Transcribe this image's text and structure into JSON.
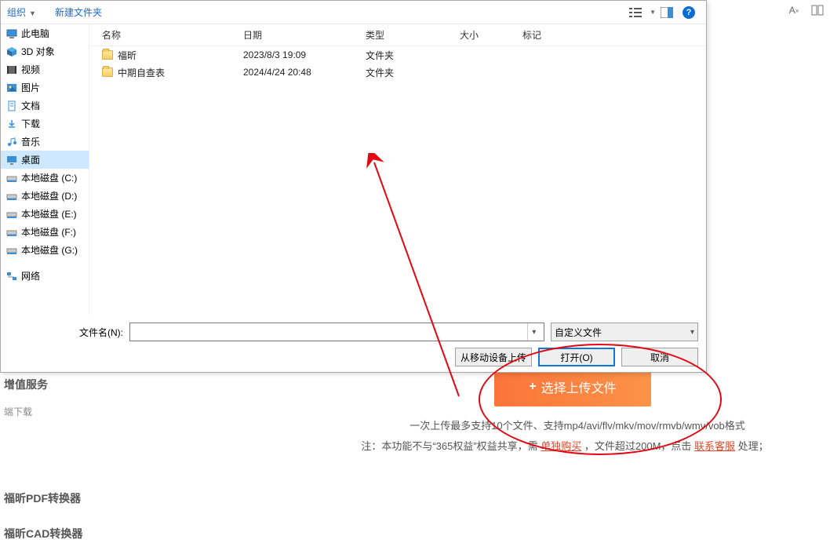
{
  "toolbar": {
    "organize": "组织",
    "newfolder": "新建文件夹"
  },
  "sidebar": {
    "items": [
      {
        "label": "此电脑"
      },
      {
        "label": "3D 对象"
      },
      {
        "label": "视频"
      },
      {
        "label": "图片"
      },
      {
        "label": "文档"
      },
      {
        "label": "下载"
      },
      {
        "label": "音乐"
      },
      {
        "label": "桌面"
      },
      {
        "label": "本地磁盘 (C:)"
      },
      {
        "label": "本地磁盘 (D:)"
      },
      {
        "label": "本地磁盘 (E:)"
      },
      {
        "label": "本地磁盘 (F:)"
      },
      {
        "label": "本地磁盘 (G:)"
      },
      {
        "label": ""
      },
      {
        "label": "网络"
      }
    ]
  },
  "columns": {
    "name": "名称",
    "date": "日期",
    "type": "类型",
    "size": "大小",
    "tag": "标记"
  },
  "files": [
    {
      "name": "福昕",
      "date": "2023/8/3 19:09",
      "type": "文件夹",
      "size": ""
    },
    {
      "name": "中期自查表",
      "date": "2024/4/24 20:48",
      "type": "文件夹",
      "size": ""
    }
  ],
  "filenameLabel": "文件名(N):",
  "filetypeLabel": "自定义文件",
  "btn_mobile": "从移动设备上传",
  "btn_open": "打开(O)",
  "btn_cancel": "取消",
  "uploadBtn": "选择上传文件",
  "info1": "一次上传最多支持10个文件、支持mp4/avi/flv/mkv/mov/rmvb/wmv/vob格式",
  "info2_a": "注：本功能不与“365权益”权益共享，需 ",
  "info2_link1": "单独购买",
  "info2_b": " ，文件超过200M，点击 ",
  "info2_link2": "联系客服",
  "info2_c": " 处理；",
  "left": {
    "a": "增值服务",
    "b": "端下载",
    "c": "福昕PDF转换器",
    "d": "福昕CAD转换器"
  }
}
